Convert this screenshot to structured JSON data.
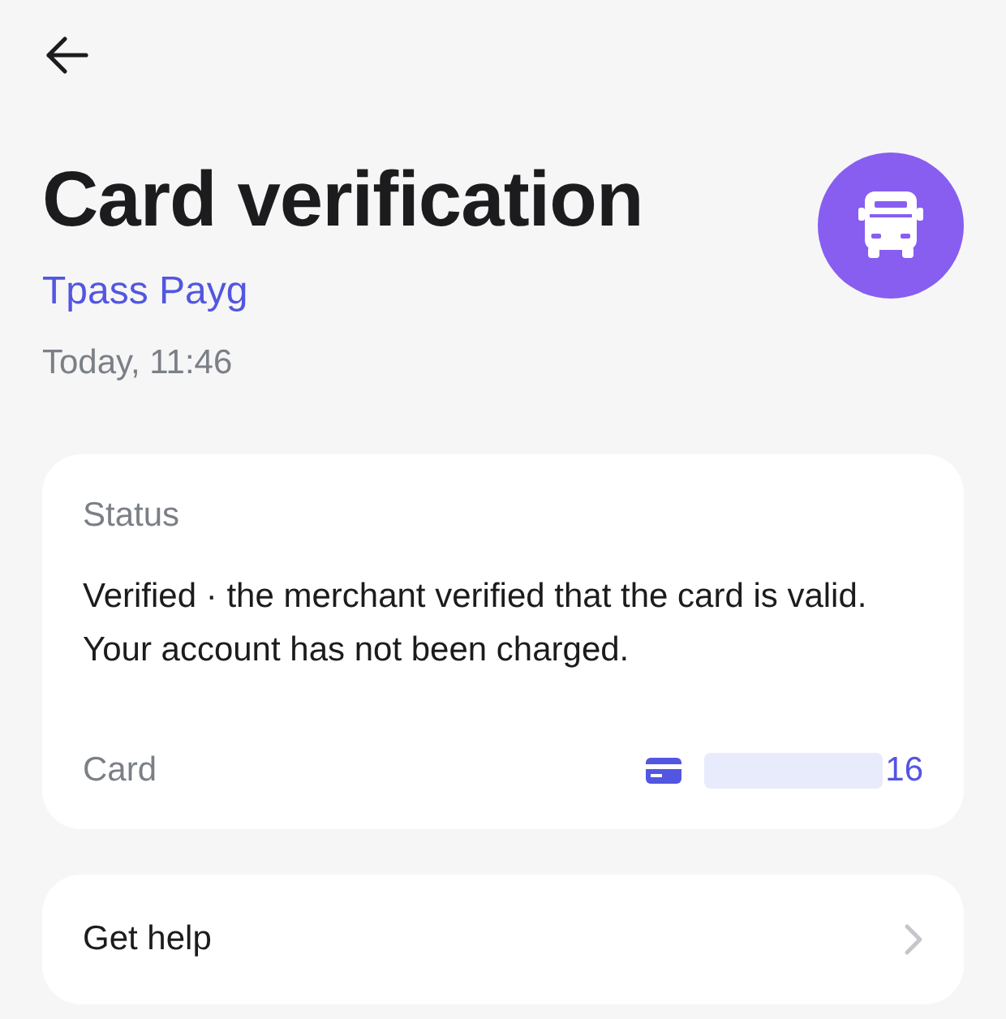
{
  "header": {
    "title": "Card verification",
    "merchant": "Tpass Payg",
    "time": "Today, 11:46"
  },
  "status": {
    "label": "Status",
    "text": "Verified · the merchant verified that the card is valid. Your account has not been charged."
  },
  "card": {
    "label": "Card",
    "value": "16"
  },
  "help": {
    "label": "Get help"
  }
}
